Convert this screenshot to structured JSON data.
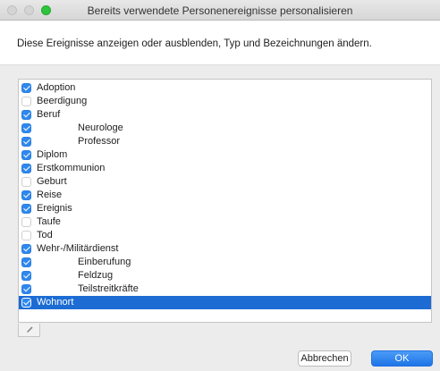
{
  "window": {
    "title": "Bereits verwendete Personenereignisse personalisieren",
    "traffic_lights": {
      "close": "inactive",
      "minimize": "inactive",
      "maximize_color": "#2ec43d"
    }
  },
  "instruction": "Diese Ereignisse anzeigen oder ausblenden, Typ und Bezeichnungen ändern.",
  "events": [
    {
      "label": "Adoption",
      "checked": true,
      "level": 0,
      "selected": false
    },
    {
      "label": "Beerdigung",
      "checked": false,
      "level": 0,
      "selected": false
    },
    {
      "label": "Beruf",
      "checked": true,
      "level": 0,
      "selected": false
    },
    {
      "label": "Neurologe",
      "checked": true,
      "level": 1,
      "selected": false
    },
    {
      "label": "Professor",
      "checked": true,
      "level": 1,
      "selected": false
    },
    {
      "label": "Diplom",
      "checked": true,
      "level": 0,
      "selected": false
    },
    {
      "label": "Erstkommunion",
      "checked": true,
      "level": 0,
      "selected": false
    },
    {
      "label": "Geburt",
      "checked": false,
      "level": 0,
      "selected": false
    },
    {
      "label": "Reise",
      "checked": true,
      "level": 0,
      "selected": false
    },
    {
      "label": "Ereignis",
      "checked": true,
      "level": 0,
      "selected": false
    },
    {
      "label": "Taufe",
      "checked": false,
      "level": 0,
      "selected": false
    },
    {
      "label": "Tod",
      "checked": false,
      "level": 0,
      "selected": false
    },
    {
      "label": "Wehr-/Militärdienst",
      "checked": true,
      "level": 0,
      "selected": false
    },
    {
      "label": "Einberufung",
      "checked": true,
      "level": 1,
      "selected": false
    },
    {
      "label": "Feldzug",
      "checked": true,
      "level": 1,
      "selected": false
    },
    {
      "label": "Teilstreitkräfte",
      "checked": true,
      "level": 1,
      "selected": false
    },
    {
      "label": "Wohnort",
      "checked": true,
      "level": 0,
      "selected": true
    }
  ],
  "edit_button": {
    "icon": "pencil-icon"
  },
  "buttons": {
    "cancel": "Abbrechen",
    "ok": "OK"
  },
  "colors": {
    "selection": "#1c6cd4",
    "checkbox_checked": "#2f88ee",
    "primary_button": "#1e74e6"
  }
}
